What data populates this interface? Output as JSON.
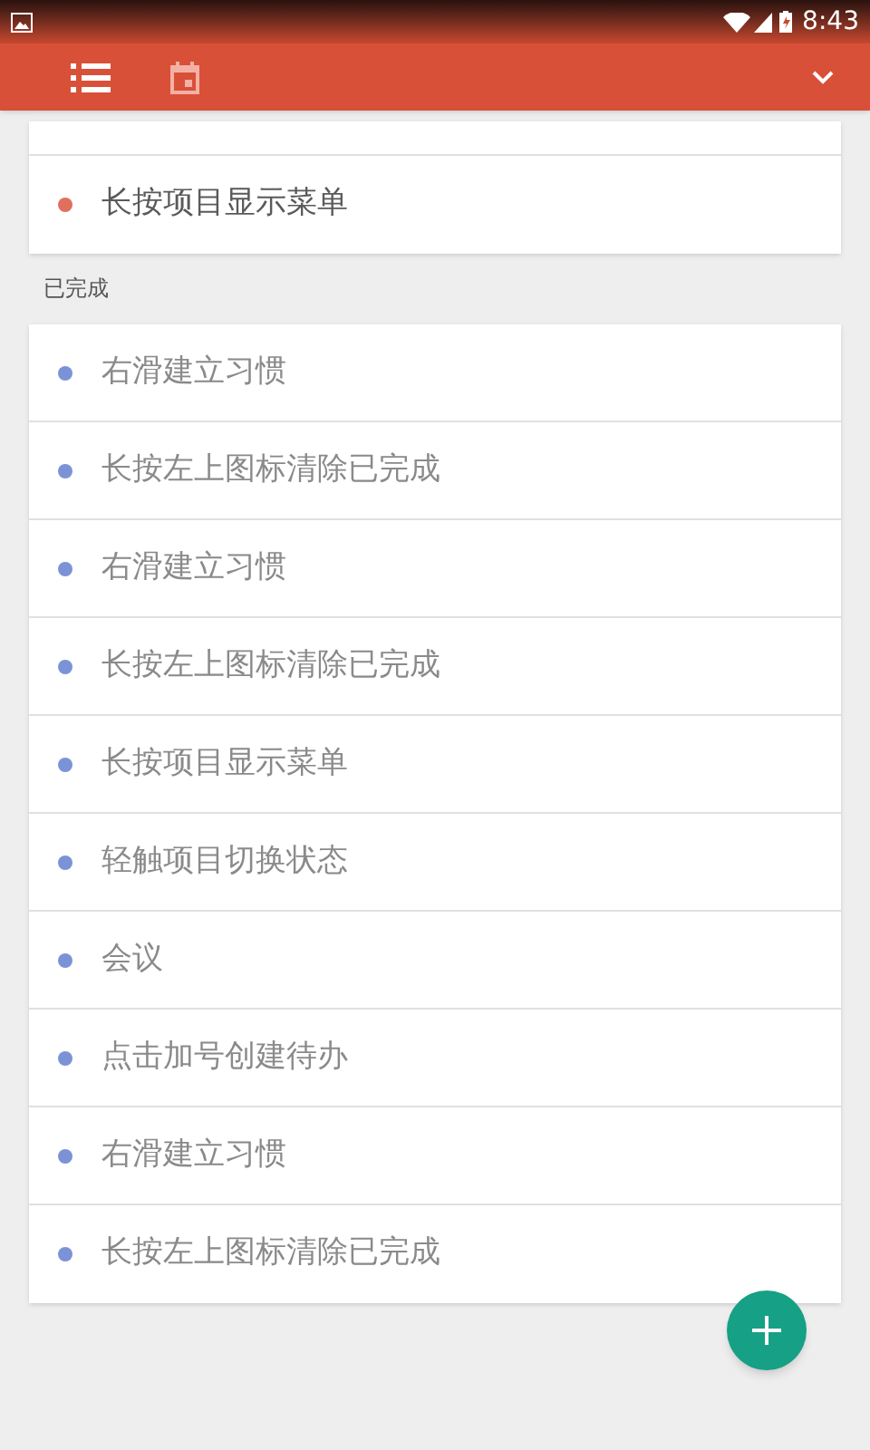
{
  "status_bar": {
    "time": "8:43"
  },
  "app_bar": {
    "tabs": [
      {
        "kind": "list",
        "selected": true
      },
      {
        "kind": "calendar",
        "selected": false
      }
    ]
  },
  "pending": {
    "items": [
      {
        "label": "长按项目显示菜单",
        "color": "#e0705e"
      }
    ]
  },
  "completed": {
    "title": "已完成",
    "items": [
      {
        "label": "右滑建立习惯",
        "color": "#7b93d6"
      },
      {
        "label": "长按左上图标清除已完成",
        "color": "#7b93d6"
      },
      {
        "label": "右滑建立习惯",
        "color": "#7b93d6"
      },
      {
        "label": "长按左上图标清除已完成",
        "color": "#7b93d6"
      },
      {
        "label": "长按项目显示菜单",
        "color": "#7b93d6"
      },
      {
        "label": "轻触项目切换状态",
        "color": "#7b93d6"
      },
      {
        "label": "会议",
        "color": "#7b93d6"
      },
      {
        "label": "点击加号创建待办",
        "color": "#7b93d6"
      },
      {
        "label": "右滑建立习惯",
        "color": "#7b93d6"
      },
      {
        "label": "长按左上图标清除已完成",
        "color": "#7b93d6"
      }
    ]
  }
}
